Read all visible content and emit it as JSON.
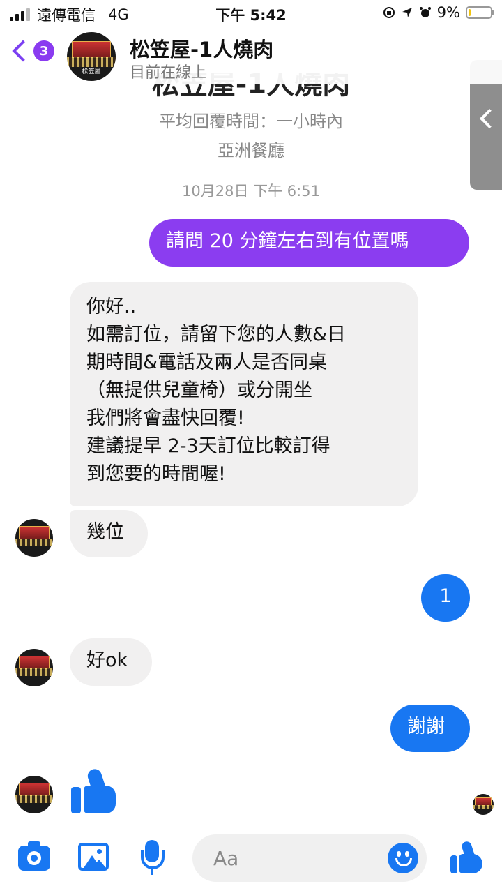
{
  "status_bar": {
    "carrier": "遠傳電信",
    "network": "4G",
    "time": "下午 5:42",
    "battery": "9%"
  },
  "header": {
    "unread_count": "3",
    "name": "松笠屋-1人燒肉",
    "presence": "目前在線上"
  },
  "profile": {
    "name_partial": "松笠屋-1人燒肉",
    "response_time": "平均回覆時間：一小時內",
    "category": "亞洲餐廳"
  },
  "conversation": {
    "timestamp": "10月28日 下午 6:51",
    "messages": [
      {
        "from": "me",
        "text": "請問 20 分鐘左右到有位置嗎"
      },
      {
        "from": "page",
        "lines": [
          "你好..",
          "如需訂位，請留下您的人數&日",
          "期時間&電話及兩人是否同桌",
          "（無提供兒童椅）或分開坐",
          "我們將會盡快回覆!",
          "建議提早 2-3天訂位比較訂得",
          "到您要的時間喔!"
        ]
      },
      {
        "from": "page",
        "text": "幾位"
      },
      {
        "from": "me",
        "text": "1"
      },
      {
        "from": "page",
        "text": "好ok"
      },
      {
        "from": "me",
        "text": "謝謝"
      }
    ],
    "avatar_caption": "松笠屋"
  },
  "composer": {
    "placeholder": "Aa"
  },
  "colors": {
    "accent_purple": "#8b3df0",
    "accent_blue": "#1877f2",
    "incoming_bubble": "#f1f0f0"
  },
  "icons": [
    "camera-icon",
    "gallery-icon",
    "microphone-icon",
    "emoji-icon",
    "like-icon",
    "back-chevron-icon"
  ]
}
